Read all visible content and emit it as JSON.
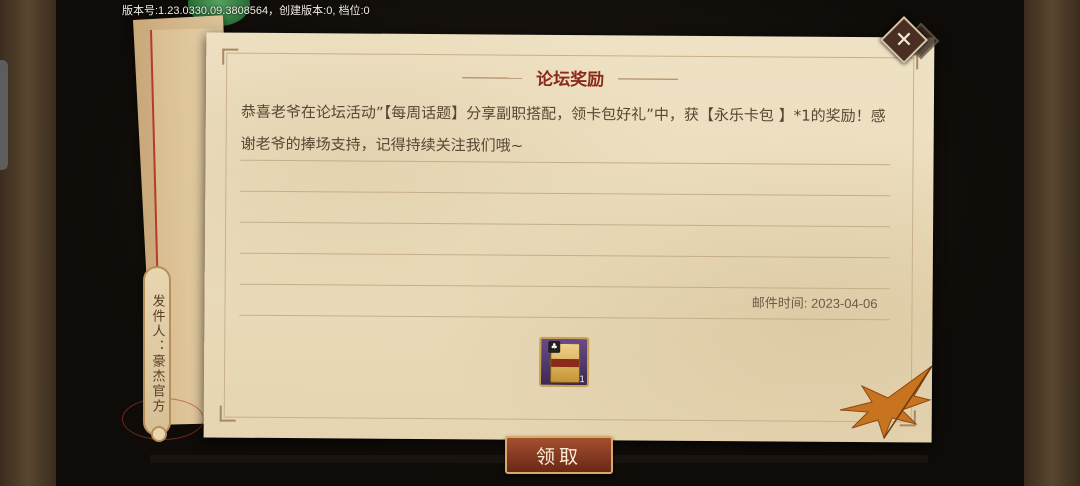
{
  "version_text": "版本号:1.23.0330.09.3808564，创建版本:0, 档位:0",
  "mail": {
    "title": "论坛奖励",
    "message": "恭喜老爷在论坛活动”【每周话题】分享副职搭配，领卡包好礼”中，获【永乐卡包 】*1的奖励！感谢老爷的捧场支持，记得持续关注我们哦~",
    "time_label": "邮件时间:",
    "time_value": "2023-04-06",
    "sender": "发件人：豪杰官方",
    "reward": {
      "icon": "card-pack-icon",
      "count": "1"
    }
  },
  "buttons": {
    "claim": "领取",
    "close_icon": "close-icon"
  },
  "colors": {
    "title": "#8a2a1a",
    "text": "#5a4634",
    "button": "#8a3a22"
  }
}
